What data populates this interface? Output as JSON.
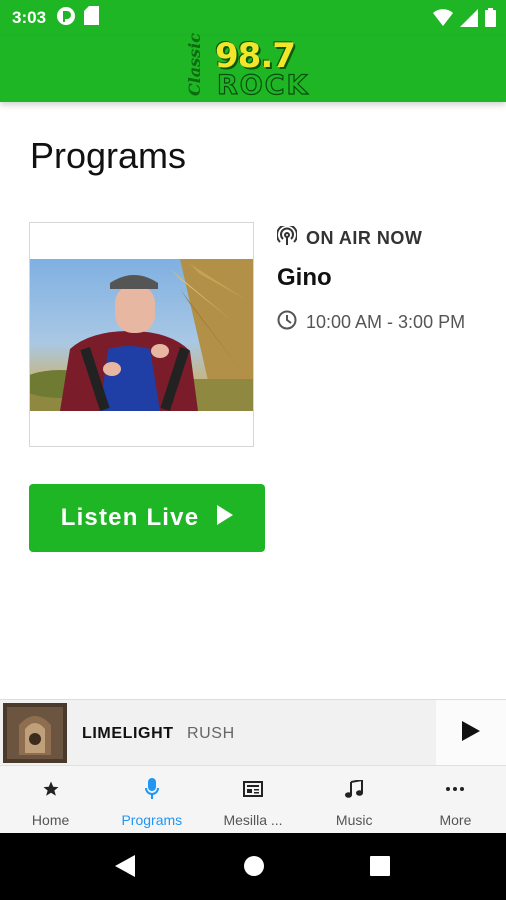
{
  "status_bar": {
    "time": "3:03"
  },
  "header": {
    "logo": {
      "classic": "Classic",
      "frequency": "98.7",
      "rock": "ROCK"
    }
  },
  "page": {
    "title": "Programs"
  },
  "program": {
    "on_air_label": "ON AIR NOW",
    "host": "Gino",
    "time_range": "10:00 AM - 3:00 PM"
  },
  "listen_button": {
    "label": "Listen Live"
  },
  "now_playing": {
    "title": "LIMELIGHT",
    "artist": "RUSH"
  },
  "bottom_nav": {
    "items": [
      {
        "label": "Home",
        "icon": "star-icon",
        "active": false
      },
      {
        "label": "Programs",
        "icon": "microphone-icon",
        "active": true
      },
      {
        "label": "Mesilla ...",
        "icon": "newspaper-icon",
        "active": false
      },
      {
        "label": "Music",
        "icon": "music-note-icon",
        "active": false
      },
      {
        "label": "More",
        "icon": "more-dots-icon",
        "active": false
      }
    ]
  },
  "colors": {
    "brand_green": "#1fb626",
    "logo_yellow": "#f1e62a",
    "active_blue": "#2196f3"
  }
}
